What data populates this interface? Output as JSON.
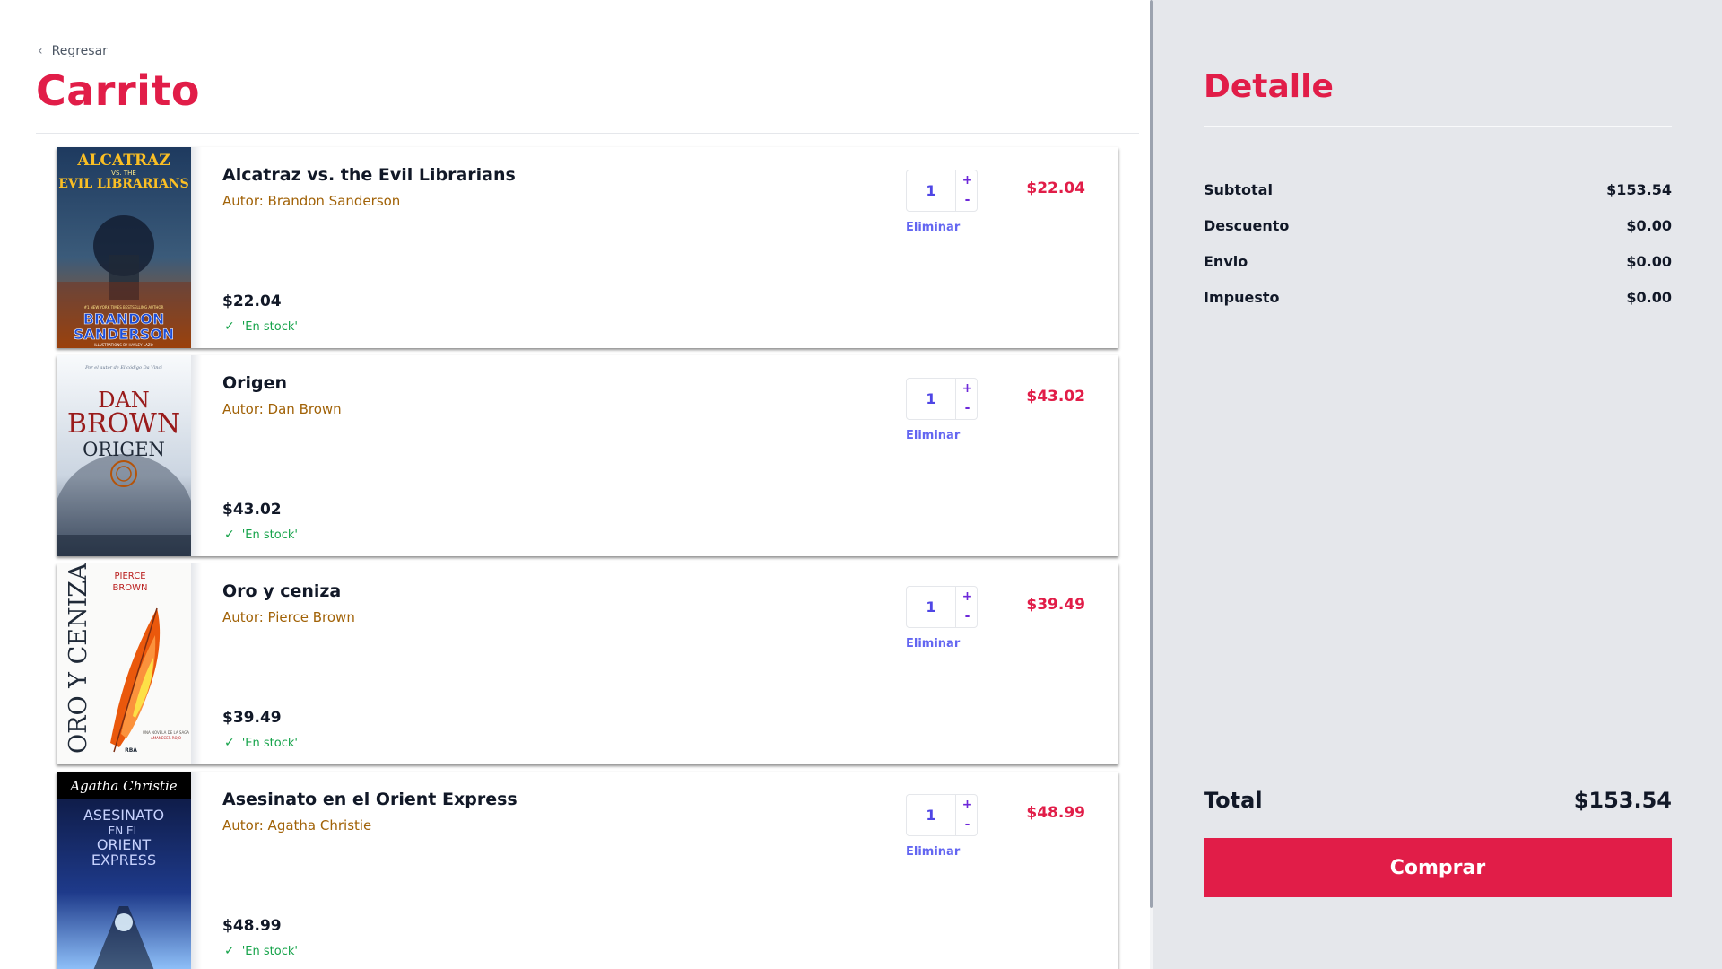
{
  "nav": {
    "back_label": "Regresar"
  },
  "cart": {
    "title": "Carrito",
    "remove_label": "Eliminar",
    "items": [
      {
        "title": "Alcatraz vs. the Evil Librarians",
        "author": "Autor: Brandon Sanderson",
        "price": "$22.04",
        "stock": "'En stock'",
        "quantity": "1",
        "line_total": "$22.04",
        "cover": {
          "top_text": "ALCATRAZ",
          "sub_text": "EVIL LIBRARIANS",
          "vs_text": "VS. THE",
          "bottom_text": "BRANDON",
          "bottom_text2": "SANDERSON",
          "note": "#1 NEW YORK TIMES BESTSELLING AUTHOR",
          "illus": "ILLUSTRATIONS BY HAYLEY LAZO"
        }
      },
      {
        "title": "Origen",
        "author": "Autor: Dan Brown",
        "price": "$43.02",
        "stock": "'En stock'",
        "quantity": "1",
        "line_total": "$43.02",
        "cover": {
          "tag": "Por el autor de El código Da Vinci",
          "name1": "DAN",
          "name2": "BROWN",
          "book": "ORIGEN"
        }
      },
      {
        "title": "Oro y ceniza",
        "author": "Autor: Pierce Brown",
        "price": "$39.49",
        "stock": "'En stock'",
        "quantity": "1",
        "line_total": "$39.49",
        "cover": {
          "vertical": "ORO Y CENIZA",
          "author1": "PIERCE",
          "author2": "BROWN",
          "note": "UNA NOVELA DE LA SAGA",
          "series": "AMANECER ROJO",
          "pub": "RBA"
        }
      },
      {
        "title": "Asesinato en el Orient Express",
        "author": "Autor: Agatha Christie",
        "price": "$48.99",
        "stock": "'En stock'",
        "quantity": "1",
        "line_total": "$48.99",
        "cover": {
          "signature": "Agatha Christie",
          "line1": "ASESINATO",
          "line2": "EN EL",
          "line3": "ORIENT",
          "line4": "EXPRESS"
        }
      }
    ]
  },
  "detail": {
    "title": "Detalle",
    "rows": [
      {
        "label": "Subtotal",
        "value": "$153.54"
      },
      {
        "label": "Descuento",
        "value": "$0.00"
      },
      {
        "label": "Envio",
        "value": "$0.00"
      },
      {
        "label": "Impuesto",
        "value": "$0.00"
      }
    ],
    "total_label": "Total",
    "total_value": "$153.54",
    "buy_label": "Comprar"
  },
  "icons": {
    "back": "chevron-left-icon",
    "stock": "check-icon"
  },
  "colors": {
    "accent": "#e11d48",
    "author": "#a16207",
    "stock": "#16a34a",
    "link": "#6366f1",
    "sidebar_bg": "#e5e7eb"
  }
}
